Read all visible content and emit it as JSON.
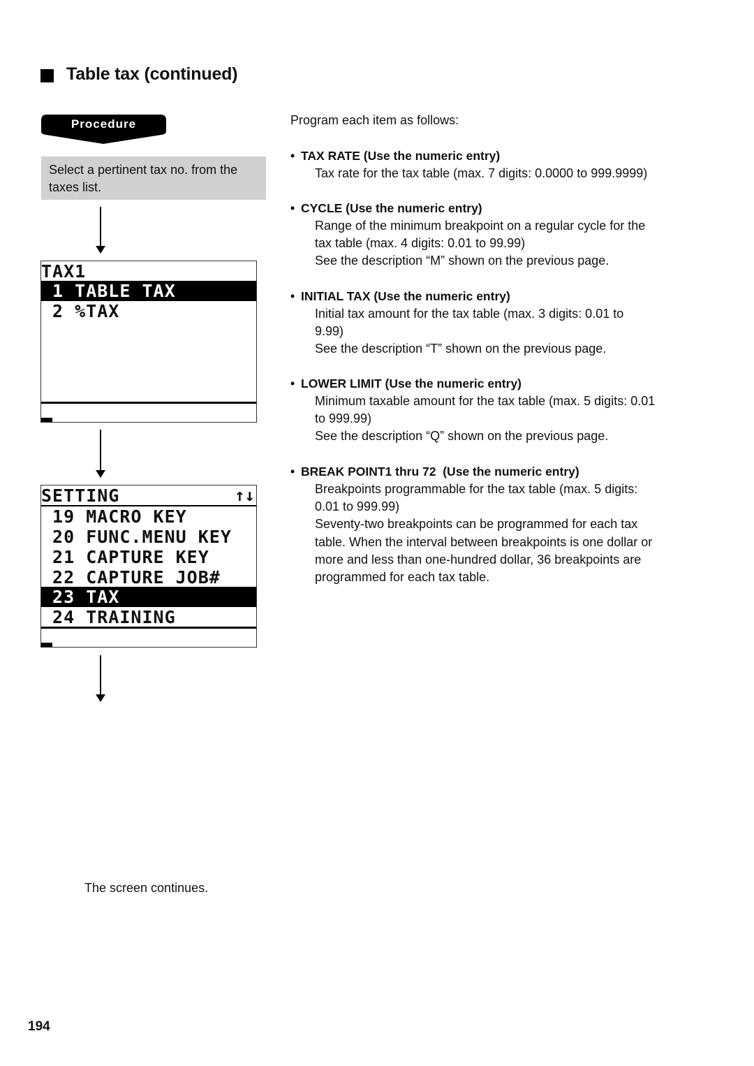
{
  "heading": {
    "marker_icon": "black-square",
    "title": "Table tax (continued)"
  },
  "procedure": {
    "label": "Procedure",
    "instruction": "Select a pertinent tax no. from the taxes list."
  },
  "screens": [
    {
      "title": "TAX1",
      "rows": [
        {
          "text": " 1 TABLE TAX",
          "highlighted": true
        },
        {
          "text": " 2 %TAX",
          "highlighted": false
        }
      ]
    },
    {
      "title": "SETTING",
      "scroll_indicator": "↑↓",
      "rows": [
        {
          "text": " 19 MACRO KEY",
          "highlighted": false
        },
        {
          "text": " 20 FUNC.MENU KEY",
          "highlighted": false
        },
        {
          "text": " 21 CAPTURE KEY",
          "highlighted": false
        },
        {
          "text": " 22 CAPTURE JOB#",
          "highlighted": false
        },
        {
          "text": " 23 TAX",
          "highlighted": true
        },
        {
          "text": " 24 TRAINING",
          "highlighted": false
        }
      ]
    }
  ],
  "continues_text": "The screen continues.",
  "right": {
    "intro": "Program each item as follows:",
    "bullet": "•",
    "items": [
      {
        "title": "TAX RATE (Use the numeric entry)",
        "lines": [
          "Tax rate for the tax table (max. 7 digits: 0.0000 to 999.9999)"
        ]
      },
      {
        "title": "CYCLE (Use the numeric entry)",
        "lines": [
          "Range of the minimum breakpoint on a regular cycle for the",
          "tax table (max. 4 digits: 0.01 to 99.99)",
          "See the description “M” shown on the previous page."
        ]
      },
      {
        "title": "INITIAL TAX (Use the numeric entry)",
        "lines": [
          "Initial tax amount for the tax table (max. 3 digits: 0.01 to",
          "9.99)",
          "See the description “T” shown on the previous page."
        ]
      },
      {
        "title": "LOWER LIMIT (Use the numeric entry)",
        "lines": [
          "Minimum taxable amount for the tax table (max. 5 digits: 0.01",
          "to 999.99)",
          "See the description “Q” shown on the previous page."
        ]
      },
      {
        "title": "BREAK POINT1 thru 72  (Use the numeric entry)",
        "lines": [
          "Breakpoints programmable for the tax table (max. 5 digits:",
          "0.01 to 999.99)",
          "Seventy-two breakpoints can be programmed for each tax",
          "table. When the interval between breakpoints is one dollar or",
          "more and less than one-hundred dollar, 36 breakpoints are",
          "programmed for each tax table."
        ]
      }
    ]
  },
  "page_number": "194"
}
